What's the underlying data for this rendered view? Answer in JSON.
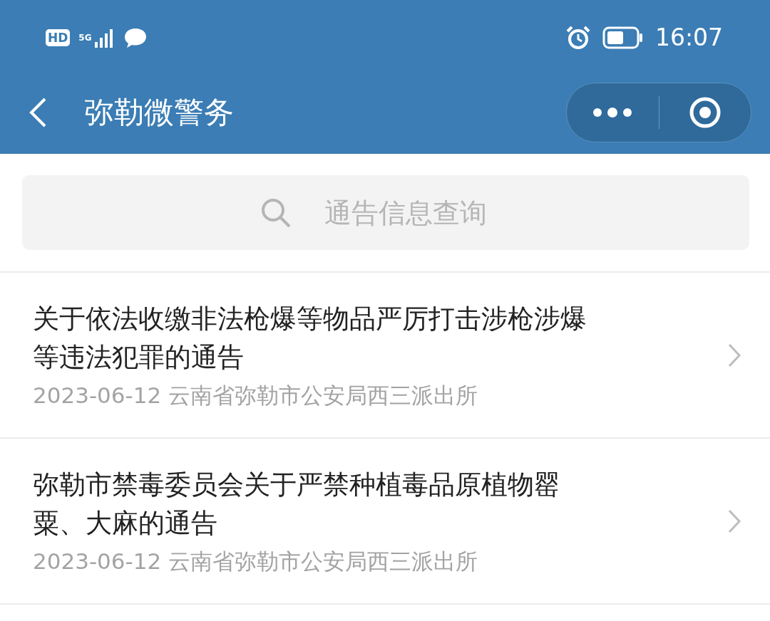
{
  "status_bar": {
    "network_badge": "HD",
    "network_type": "5G",
    "time": "16:07"
  },
  "nav_bar": {
    "title": "弥勒微警务"
  },
  "search": {
    "placeholder": "通告信息查询"
  },
  "notices": [
    {
      "title_lines": [
        "关于依法收缴非法枪爆等物品严厉打击涉枪涉爆",
        "等违法犯罪的通告"
      ],
      "date": "2023-06-12",
      "source": "云南省弥勒市公安局西三派出所"
    },
    {
      "title_lines": [
        "弥勒市禁毒委员会关于严禁种植毒品原植物罂",
        "粟、大麻的通告"
      ],
      "date": "2023-06-12",
      "source": "云南省弥勒市公安局西三派出所"
    }
  ]
}
